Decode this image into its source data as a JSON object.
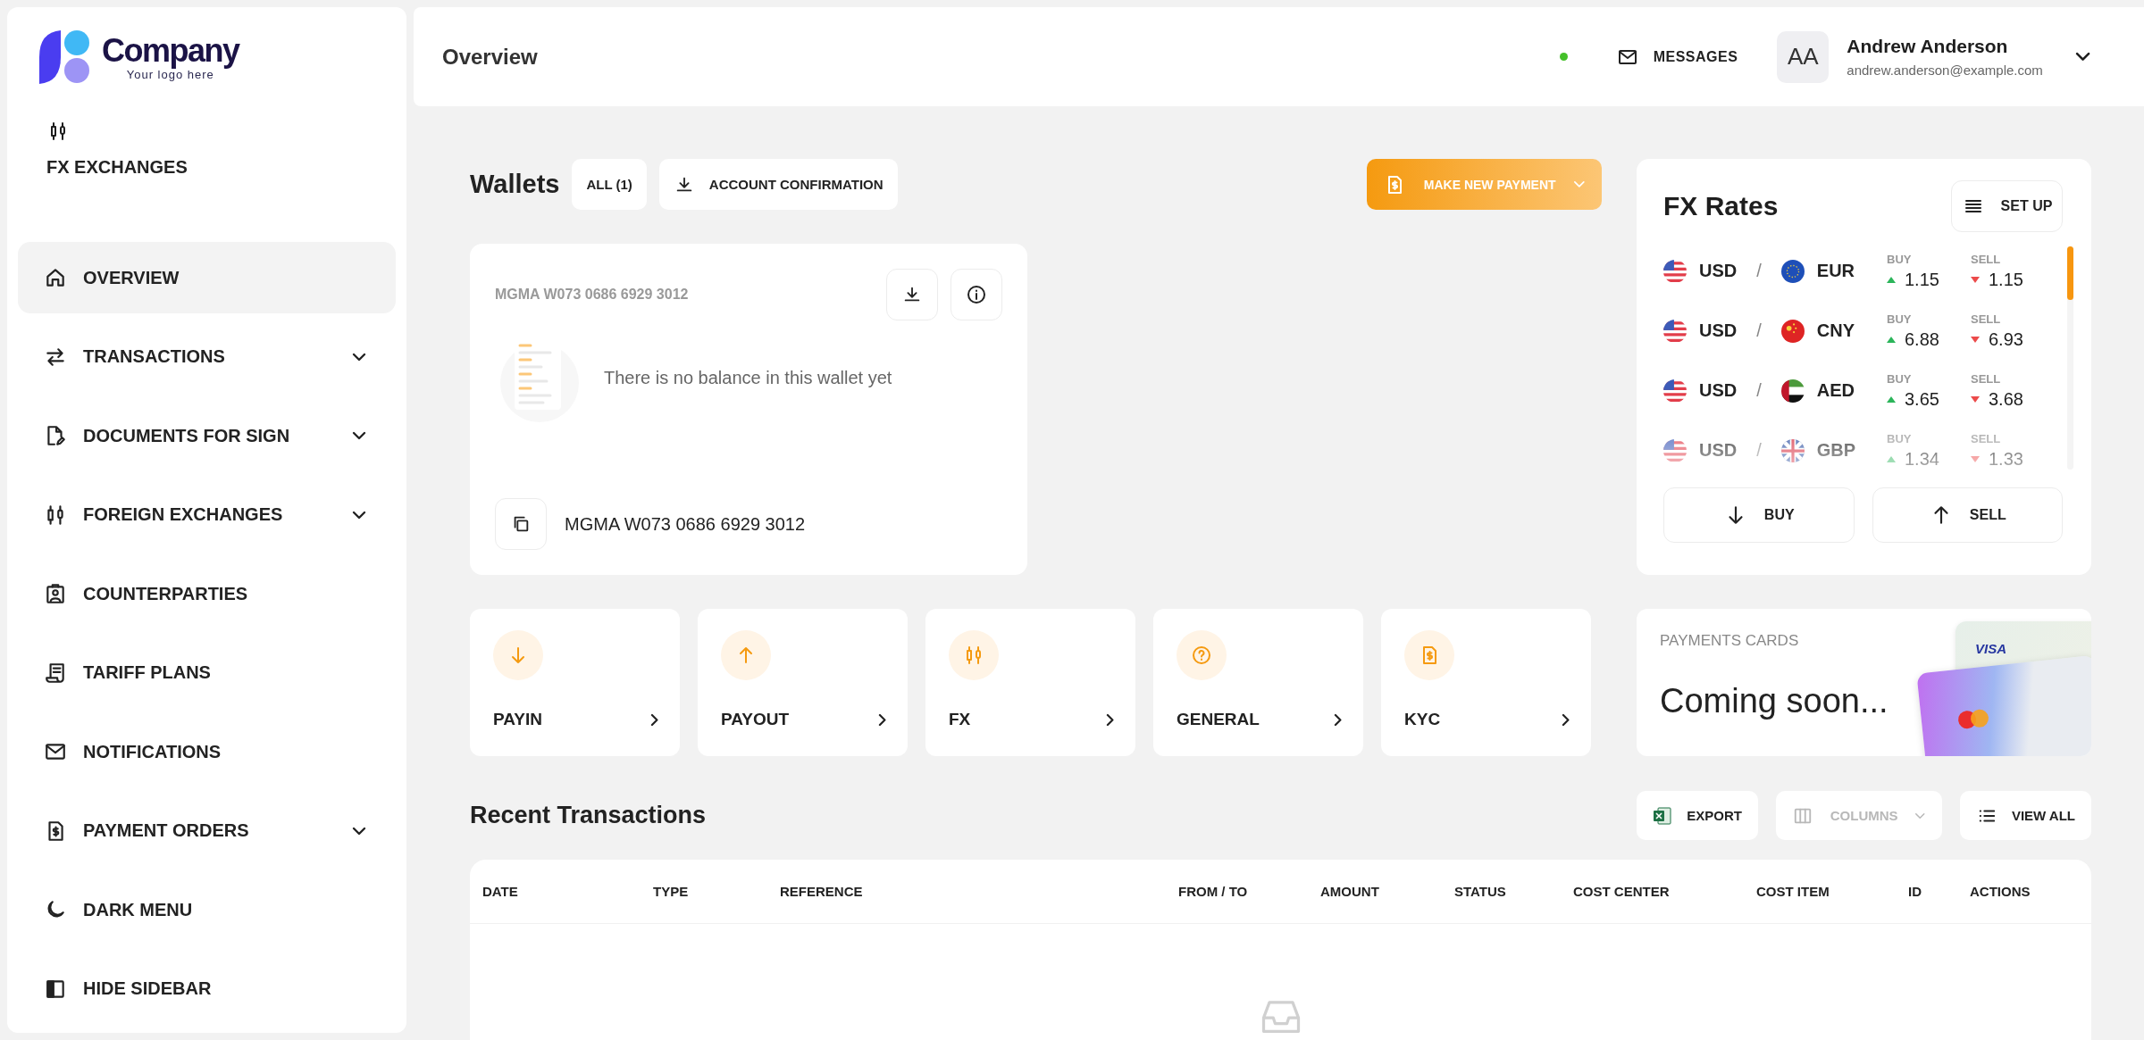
{
  "brand": {
    "name": "Company",
    "tagline": "Your logo here"
  },
  "section": {
    "label": "FX EXCHANGES"
  },
  "sidebar": {
    "items": [
      {
        "label": "OVERVIEW",
        "selected": true,
        "expandable": false
      },
      {
        "label": "TRANSACTIONS",
        "selected": false,
        "expandable": true
      },
      {
        "label": "DOCUMENTS FOR SIGN",
        "selected": false,
        "expandable": true
      },
      {
        "label": "FOREIGN EXCHANGES",
        "selected": false,
        "expandable": true
      },
      {
        "label": "COUNTERPARTIES",
        "selected": false,
        "expandable": false
      },
      {
        "label": "TARIFF PLANS",
        "selected": false,
        "expandable": false
      },
      {
        "label": "NOTIFICATIONS",
        "selected": false,
        "expandable": false
      },
      {
        "label": "PAYMENT ORDERS",
        "selected": false,
        "expandable": true
      },
      {
        "label": "DARK MENU",
        "selected": false,
        "expandable": false
      },
      {
        "label": "HIDE SIDEBAR",
        "selected": false,
        "expandable": false
      }
    ]
  },
  "topbar": {
    "title": "Overview",
    "online": true,
    "messages_label": "MESSAGES",
    "user": {
      "initials": "AA",
      "name": "Andrew Anderson",
      "email": "andrew.anderson@example.com"
    }
  },
  "wallets": {
    "title": "Wallets",
    "filter_label": "ALL (1)",
    "confirmation_label": "ACCOUNT CONFIRMATION",
    "payment_label": "MAKE NEW PAYMENT",
    "card": {
      "account": "MGMA W073 0686 6929 3012",
      "empty_message": "There is no balance in this wallet yet",
      "account_footer": "MGMA W073 0686 6929 3012"
    }
  },
  "fx_rates": {
    "title": "FX Rates",
    "setup_label": "SET UP",
    "rates": [
      {
        "base": "USD",
        "separator": "/",
        "quote": "EUR",
        "buy_label": "BUY",
        "buy": "1.15",
        "sell_label": "SELL",
        "sell": "1.15"
      },
      {
        "base": "USD",
        "separator": "/",
        "quote": "CNY",
        "buy_label": "BUY",
        "buy": "6.88",
        "sell_label": "SELL",
        "sell": "6.93"
      },
      {
        "base": "USD",
        "separator": "/",
        "quote": "AED",
        "buy_label": "BUY",
        "buy": "3.65",
        "sell_label": "SELL",
        "sell": "3.68"
      },
      {
        "base": "USD",
        "separator": "/",
        "quote": "GBP",
        "buy_label": "BUY",
        "buy": "1.34",
        "sell_label": "SELL",
        "sell": "1.33"
      }
    ],
    "buttons": [
      {
        "label": "BUY"
      },
      {
        "label": "SELL"
      }
    ]
  },
  "quick_links": [
    {
      "label": "PAYIN"
    },
    {
      "label": "PAYOUT"
    },
    {
      "label": "FX"
    },
    {
      "label": "GENERAL"
    },
    {
      "label": "KYC"
    }
  ],
  "payments_card": {
    "title": "PAYMENTS CARDS",
    "message": "Coming soon...",
    "card_brand": "VISA"
  },
  "transactions": {
    "title": "Recent Transactions",
    "actions": [
      {
        "label": "EXPORT",
        "disabled": false
      },
      {
        "label": "COLUMNS",
        "disabled": true
      },
      {
        "label": "VIEW ALL",
        "disabled": false
      }
    ],
    "table": {
      "columns": [
        "DATE",
        "TYPE",
        "REFERENCE",
        "FROM / TO",
        "AMOUNT",
        "STATUS",
        "COST CENTER",
        "COST ITEM",
        "ID",
        "ACTIONS"
      ]
    }
  }
}
